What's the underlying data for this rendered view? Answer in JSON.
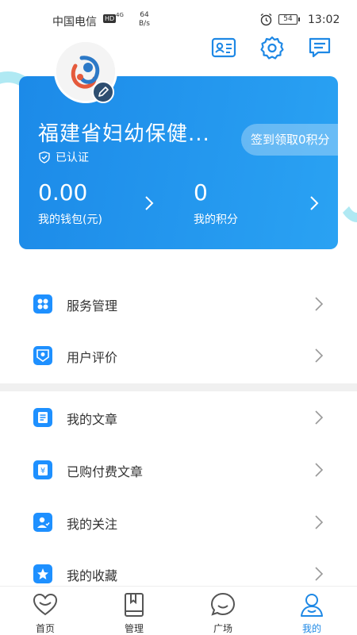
{
  "status_bar": {
    "carrier": "中国电信",
    "hd_badge": "HD",
    "network": "4G",
    "speed_value": "64",
    "speed_unit": "B/s",
    "battery": "54",
    "time": "13:02"
  },
  "header_icons": [
    "id-card-icon",
    "settings-icon",
    "message-icon"
  ],
  "profile": {
    "org_name": "福建省妇幼保健...",
    "verified_label": "已认证",
    "signin_button": "签到领取0积分",
    "wallet_value": "0.00",
    "wallet_label": "我的钱包(元)",
    "points_value": "0",
    "points_label": "我的积分"
  },
  "menu": {
    "group1": [
      {
        "label": "服务管理",
        "icon": "apps-icon"
      },
      {
        "label": "用户评价",
        "icon": "rating-icon"
      }
    ],
    "group2": [
      {
        "label": "我的文章",
        "icon": "document-icon"
      },
      {
        "label": "已购付费文章",
        "icon": "paid-article-icon"
      },
      {
        "label": "我的关注",
        "icon": "follow-icon"
      },
      {
        "label": "我的收藏",
        "icon": "star-icon"
      }
    ]
  },
  "tabbar": [
    {
      "label": "首页",
      "icon": "heart-icon",
      "active": false
    },
    {
      "label": "管理",
      "icon": "book-icon",
      "active": false
    },
    {
      "label": "广场",
      "icon": "chat-icon",
      "active": false
    },
    {
      "label": "我的",
      "icon": "person-icon",
      "active": true
    }
  ],
  "colors": {
    "accent": "#1e88e5",
    "card_start": "#1c8ae8",
    "card_end": "#2aa2f3"
  }
}
